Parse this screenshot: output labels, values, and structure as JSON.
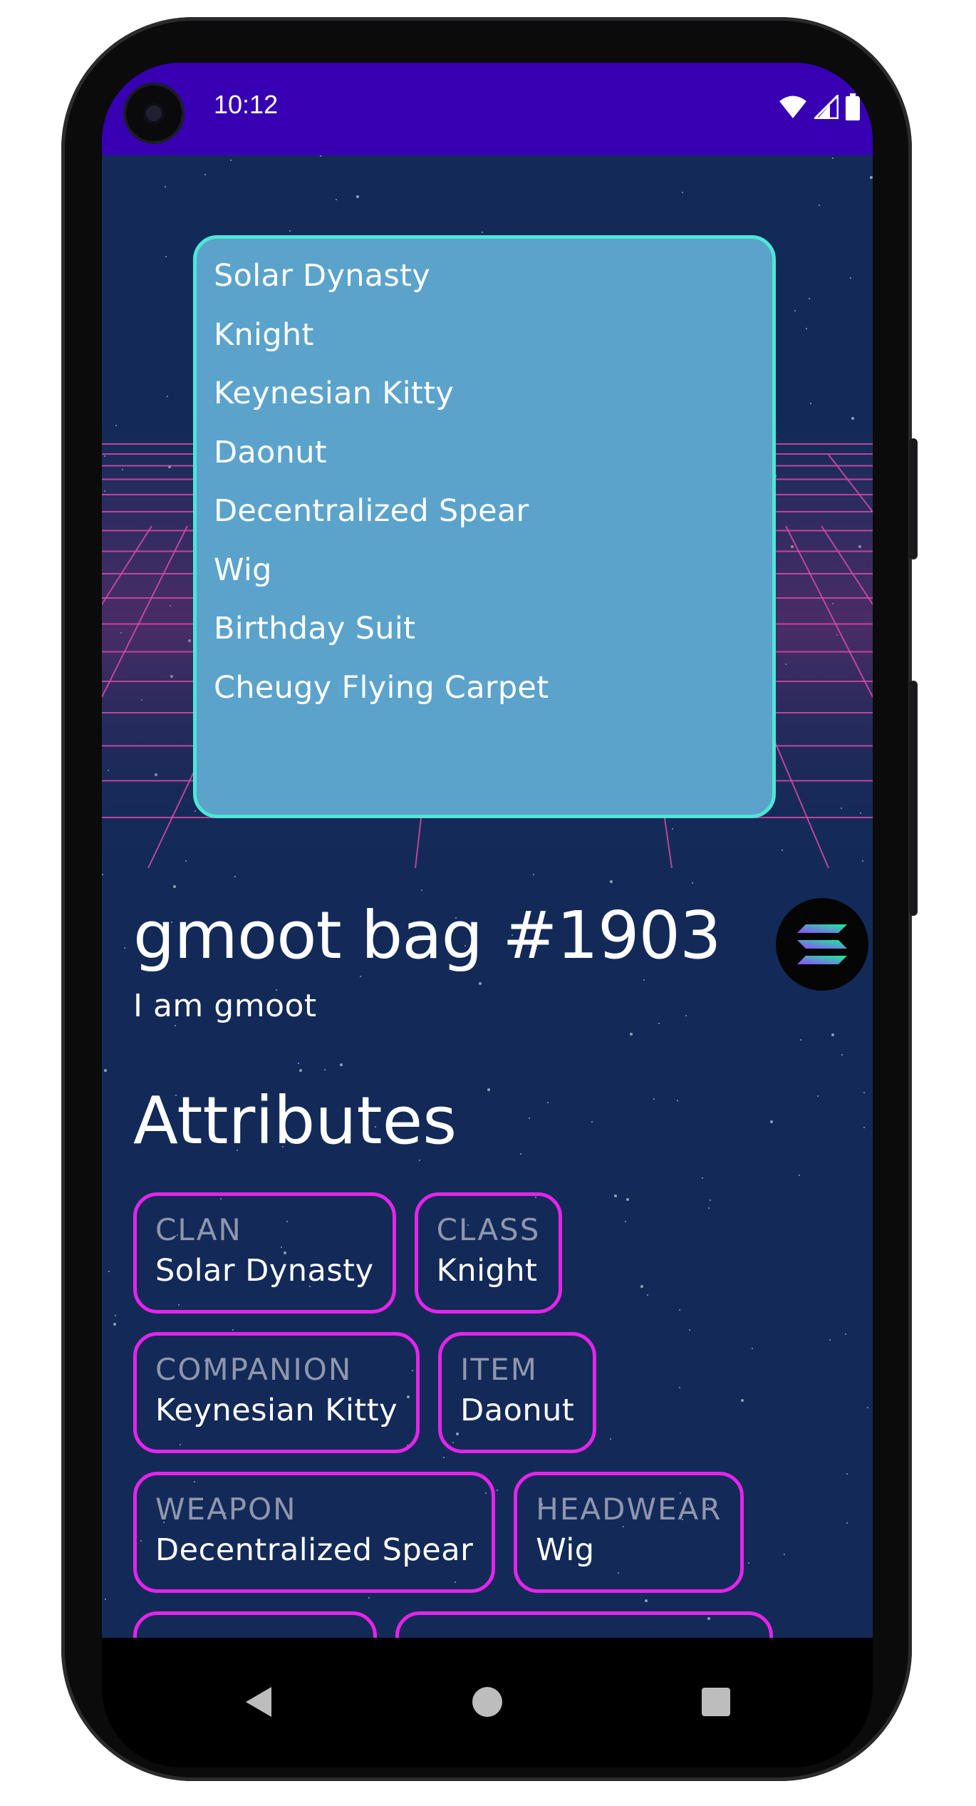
{
  "status_bar": {
    "time": "10:12",
    "icons": [
      "wifi-icon",
      "cell-signal-icon",
      "battery-icon"
    ]
  },
  "traits_list": [
    "Solar Dynasty",
    "Knight",
    "Keynesian Kitty",
    "Daonut",
    "Decentralized Spear",
    "Wig",
    "Birthday Suit",
    "Cheugy Flying Carpet"
  ],
  "nft": {
    "title": "gmoot bag #1903",
    "description": "I am gmoot",
    "chain_icon": "solana-logo-icon"
  },
  "attributes": {
    "heading": "Attributes",
    "items": [
      {
        "label": "CLAN",
        "value": "Solar Dynasty"
      },
      {
        "label": "CLASS",
        "value": "Knight"
      },
      {
        "label": "COMPANION",
        "value": "Keynesian Kitty"
      },
      {
        "label": "ITEM",
        "value": "Daonut"
      },
      {
        "label": "WEAPON",
        "value": "Decentralized Spear"
      },
      {
        "label": "HEADWEAR",
        "value": "Wig"
      }
    ]
  },
  "nav_bar": {
    "buttons": [
      "back-icon",
      "home-icon",
      "recents-icon"
    ]
  },
  "colors": {
    "status_bar": "#3700b3",
    "background": "#132a58",
    "traits_box_fill": "#5ba3cb",
    "traits_box_border": "#4de6d8",
    "chip_border": "#e424ea",
    "grid_lines": "#d0409a"
  }
}
